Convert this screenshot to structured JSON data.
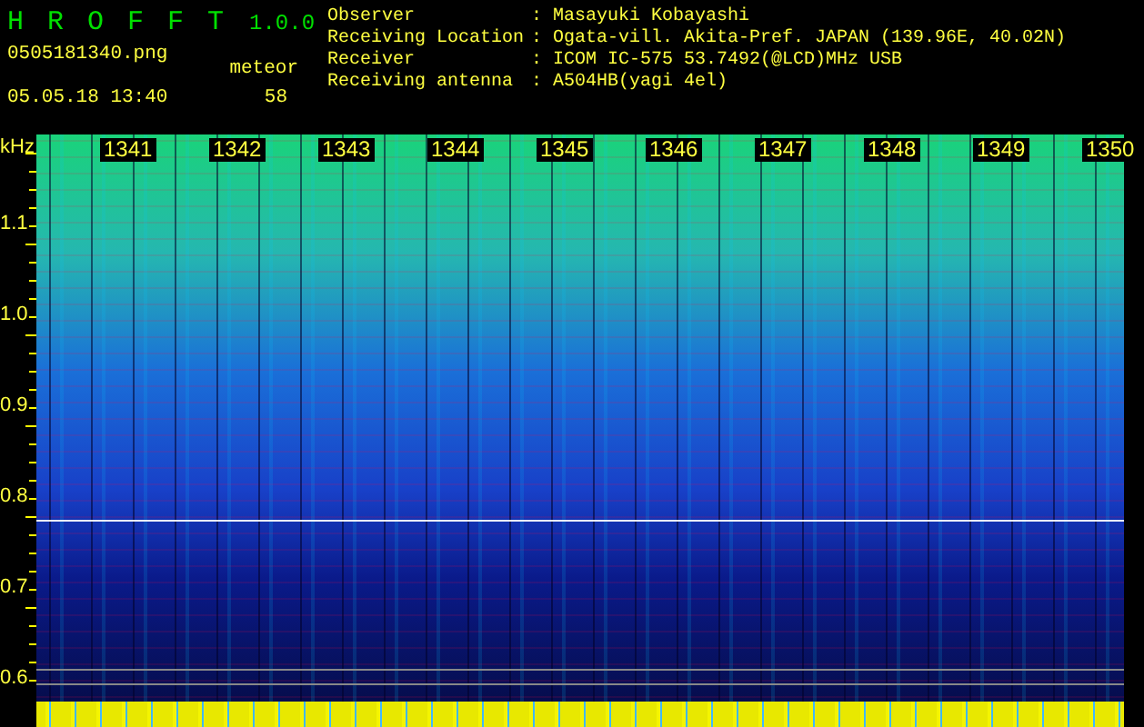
{
  "app": {
    "name": "H R O F F T",
    "version": "1.0.0"
  },
  "file_name": "0505181340.png",
  "timestamp": "05.05.18 13:40",
  "meteor": {
    "label": "meteor",
    "count": "58"
  },
  "station": [
    {
      "label": "Observer",
      "separator": ":",
      "value": "Masayuki Kobayashi"
    },
    {
      "label": "Receiving Location",
      "separator": ":",
      "value": "Ogata-vill. Akita-Pref. JAPAN (139.96E, 40.02N)"
    },
    {
      "label": "Receiver",
      "separator": ":",
      "value": "ICOM IC-575 53.7492(@LCD)MHz USB"
    },
    {
      "label": "Receiving antenna",
      "separator": ":",
      "value": "A504HB(yagi 4el)"
    }
  ],
  "spectrogram": {
    "unit": "kHz",
    "frequency_labels": [
      "1.1",
      "1.0",
      "0.9",
      "0.8",
      "0.7",
      "0.6"
    ],
    "time_labels": [
      "1341",
      "1342",
      "1343",
      "1344",
      "1345",
      "1346",
      "1347",
      "1348",
      "1349",
      "1350"
    ]
  }
}
